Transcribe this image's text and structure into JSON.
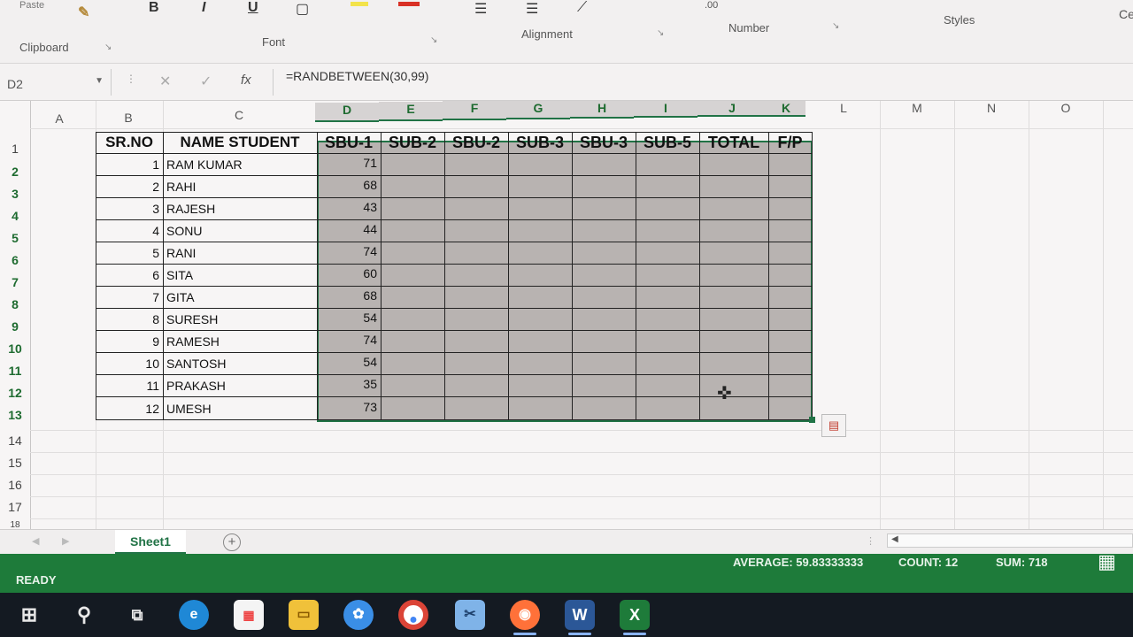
{
  "ribbon": {
    "partial_top_label": "Paste",
    "groups": [
      "Clipboard",
      "Font",
      "Alignment",
      "Number",
      "Styles"
    ],
    "partial_right_label": "Ce",
    "number_fragment": ".00",
    "bold": "B",
    "italic": "I",
    "underline": "U"
  },
  "formula_bar": {
    "name_box": "D2",
    "cancel": "✕",
    "enter": "✓",
    "fx": "fx",
    "formula": "=RANDBETWEEN(30,99)"
  },
  "columns": [
    "A",
    "B",
    "C",
    "D",
    "E",
    "F",
    "G",
    "H",
    "I",
    "J",
    "K",
    "L",
    "M",
    "N",
    "O"
  ],
  "rows": [
    "1",
    "2",
    "3",
    "4",
    "5",
    "6",
    "7",
    "8",
    "9",
    "10",
    "11",
    "12",
    "13",
    "14",
    "15",
    "16",
    "17",
    "18"
  ],
  "table": {
    "headers": [
      "SR.NO",
      "NAME STUDENT",
      "SBU-1",
      "SUB-2",
      "SBU-2",
      "SUB-3",
      "SBU-3",
      "SUB-5",
      "TOTAL",
      "F/P"
    ],
    "rows": [
      {
        "sr": "1",
        "name": "RAM KUMAR",
        "sbu1": "71"
      },
      {
        "sr": "2",
        "name": "RAHI",
        "sbu1": "68"
      },
      {
        "sr": "3",
        "name": "RAJESH",
        "sbu1": "43"
      },
      {
        "sr": "4",
        "name": "SONU",
        "sbu1": "44"
      },
      {
        "sr": "5",
        "name": "RANI",
        "sbu1": "74"
      },
      {
        "sr": "6",
        "name": "SITA",
        "sbu1": "60"
      },
      {
        "sr": "7",
        "name": "GITA",
        "sbu1": "68"
      },
      {
        "sr": "8",
        "name": "SURESH",
        "sbu1": "54"
      },
      {
        "sr": "9",
        "name": "RAMESH",
        "sbu1": "74"
      },
      {
        "sr": "10",
        "name": "SANTOSH",
        "sbu1": "54"
      },
      {
        "sr": "11",
        "name": "PRAKASH",
        "sbu1": "35"
      },
      {
        "sr": "12",
        "name": "UMESH",
        "sbu1": "73"
      }
    ]
  },
  "sheet_tabs": {
    "active": "Sheet1",
    "add": "+"
  },
  "status": {
    "mode": "READY",
    "average": "AVERAGE: 59.83333333",
    "count": "COUNT: 12",
    "sum": "SUM: 718"
  },
  "taskbar": {
    "icons": [
      "windows-start",
      "search",
      "task-view",
      "edge",
      "store",
      "file-explorer",
      "photos",
      "chrome",
      "snip",
      "firefox",
      "word",
      "excel"
    ],
    "word_label": "W",
    "excel_label": "X"
  },
  "colors": {
    "excel_green": "#1e7b3a",
    "selection_fill": "#b8b3b1"
  }
}
